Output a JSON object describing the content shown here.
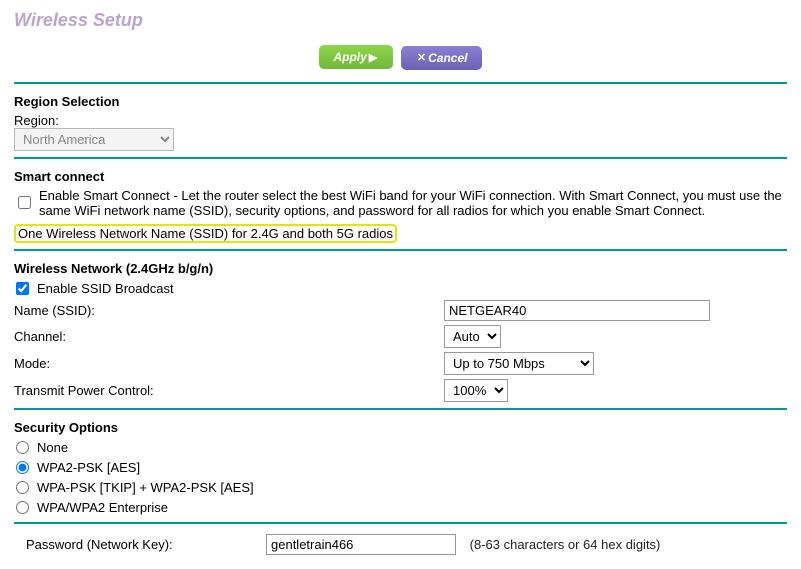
{
  "title": "Wireless Setup",
  "buttons": {
    "apply": "Apply",
    "cancel": "Cancel"
  },
  "region": {
    "heading": "Region Selection",
    "label": "Region:",
    "value": "North America"
  },
  "smart": {
    "heading": "Smart connect",
    "checkbox_label": "Enable Smart Connect - Let the router select the best WiFi band for your WiFi connection. With Smart Connect, you must use the same WiFi network name (SSID), security options, and password for all radios for which you enable Smart Connect.",
    "highlighted": "One Wireless Network Name (SSID) for 2.4G and both 5G radios"
  },
  "wn24": {
    "heading": "Wireless Network (2.4GHz b/g/n)",
    "enable_ssid": "Enable SSID Broadcast",
    "name_label": "Name (SSID):",
    "name_value": "NETGEAR40",
    "channel_label": "Channel:",
    "channel_value": "Auto",
    "mode_label": "Mode:",
    "mode_value": "Up to 750 Mbps",
    "tpc_label": "Transmit Power Control:",
    "tpc_value": "100%"
  },
  "security": {
    "heading": "Security Options",
    "options": {
      "none": "None",
      "wpa2psk_aes": "WPA2-PSK [AES]",
      "wpa_tkip_wpa2_aes": "WPA-PSK [TKIP] + WPA2-PSK [AES]",
      "wpa_enterprise": "WPA/WPA2 Enterprise"
    }
  },
  "password": {
    "label": "Password (Network Key):",
    "value": "gentletrain466",
    "hint": "(8-63 characters or 64 hex digits)"
  }
}
